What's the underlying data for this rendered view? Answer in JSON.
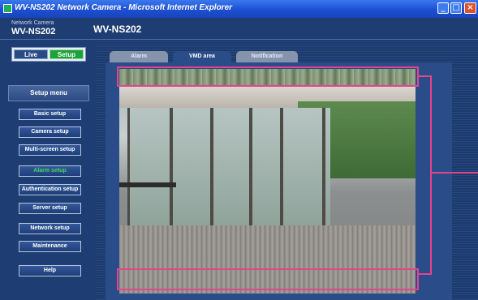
{
  "window": {
    "title": "WV-NS202 Network Camera - Microsoft Internet Explorer",
    "controls": {
      "minimize": "_",
      "maximize": "□",
      "close": "×"
    }
  },
  "header": {
    "small_label": "Network Camera",
    "model_left": "WV-NS202",
    "model_right": "WV-NS202"
  },
  "mode": {
    "live": "Live",
    "setup": "Setup",
    "selected": "Setup"
  },
  "menu": {
    "title": "Setup menu",
    "items": [
      {
        "label": "Basic setup"
      },
      {
        "label": "Camera setup"
      },
      {
        "label": "Multi-screen setup"
      },
      {
        "label": "Alarm setup"
      },
      {
        "label": "Authentication setup"
      },
      {
        "label": "Server setup"
      },
      {
        "label": "Network setup"
      },
      {
        "label": "Maintenance"
      },
      {
        "label": "Help"
      }
    ],
    "active": "Alarm setup"
  },
  "tabs": [
    {
      "label": "Alarm"
    },
    {
      "label": "VMD area"
    },
    {
      "label": "Notification"
    }
  ],
  "selected_tab": "VMD area",
  "colors": {
    "accent_green": "#1aa33a",
    "active_menu_text": "#3fd75f",
    "highlight_pink": "#e6438c",
    "panel_blue": "#2a4c88"
  }
}
